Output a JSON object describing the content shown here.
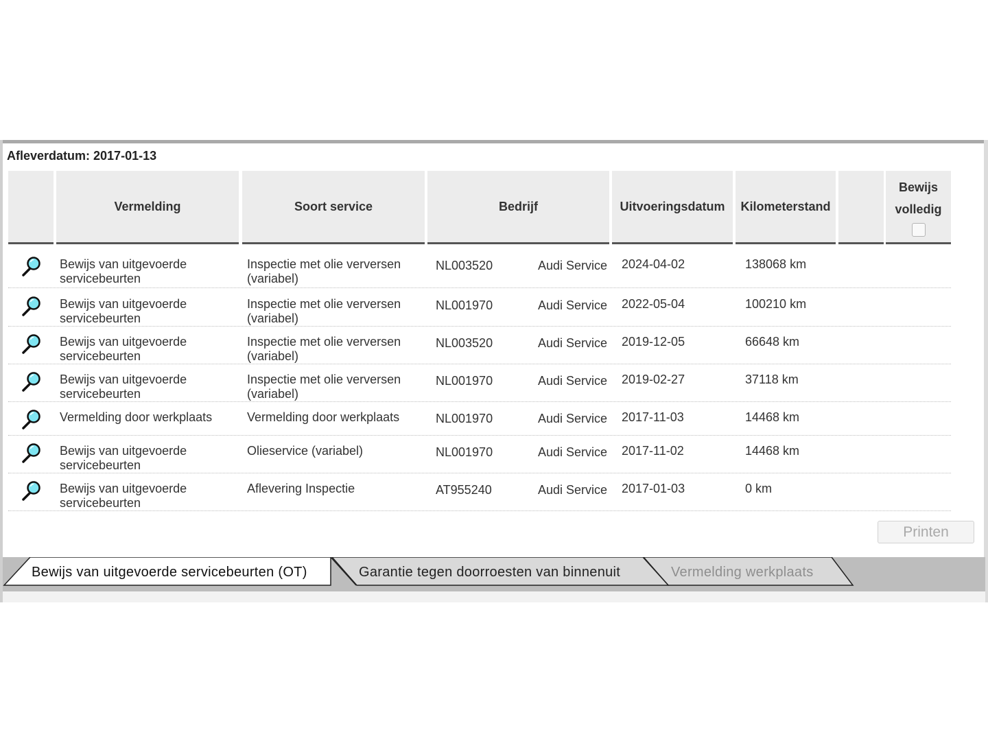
{
  "afleverdatum": "Afleverdatum: 2017-01-13",
  "headers": {
    "vermelding": "Vermelding",
    "soort_service": "Soort service",
    "bedrijf": "Bedrijf",
    "uitvoeringsdatum": "Uitvoeringsdatum",
    "kilometerstand": "Kilometerstand",
    "bewijs_line1": "Bewijs",
    "bewijs_line2": "volledig"
  },
  "rows": [
    {
      "vermelding1": "Bewijs van uitgevoerde",
      "vermelding2": "servicebeurten",
      "soort1": "Inspectie met olie verversen",
      "soort2": "(variabel)",
      "code": "NL003520",
      "bedrijf": "Audi Service",
      "datum": "2024-04-02",
      "km": "138068 km"
    },
    {
      "vermelding1": "Bewijs van uitgevoerde",
      "vermelding2": "servicebeurten",
      "soort1": "Inspectie met olie verversen",
      "soort2": "(variabel)",
      "code": "NL001970",
      "bedrijf": "Audi Service",
      "datum": "2022-05-04",
      "km": "100210 km"
    },
    {
      "vermelding1": "Bewijs van uitgevoerde",
      "vermelding2": "servicebeurten",
      "soort1": "Inspectie met olie verversen",
      "soort2": "(variabel)",
      "code": "NL003520",
      "bedrijf": "Audi Service",
      "datum": "2019-12-05",
      "km": "66648 km"
    },
    {
      "vermelding1": "Bewijs van uitgevoerde",
      "vermelding2": "servicebeurten",
      "soort1": "Inspectie met olie verversen",
      "soort2": "(variabel)",
      "code": "NL001970",
      "bedrijf": "Audi Service",
      "datum": "2019-02-27",
      "km": "37118 km"
    },
    {
      "vermelding1": "Vermelding door werkplaats",
      "vermelding2": "",
      "soort1": "Vermelding door werkplaats",
      "soort2": "",
      "code": "NL001970",
      "bedrijf": "Audi Service",
      "datum": "2017-11-03",
      "km": "14468 km"
    },
    {
      "vermelding1": "Bewijs van uitgevoerde",
      "vermelding2": "servicebeurten",
      "soort1": "Olieservice (variabel)",
      "soort2": "",
      "code": "NL001970",
      "bedrijf": "Audi Service",
      "datum": "2017-11-02",
      "km": "14468 km"
    },
    {
      "vermelding1": "Bewijs van uitgevoerde",
      "vermelding2": "servicebeurten",
      "soort1": "Aflevering Inspectie",
      "soort2": "",
      "code": "AT955240",
      "bedrijf": "Audi Service",
      "datum": "2017-01-03",
      "km": "0 km"
    }
  ],
  "print_label": "Printen",
  "tabs": {
    "active": "Bewijs van uitgevoerde servicebeurten (OT)",
    "garantie": "Garantie tegen doorroesten van binnenuit",
    "werkplaats": "Vermelding werkplaats"
  },
  "icons": {
    "row_detail": "magnifier-icon"
  }
}
